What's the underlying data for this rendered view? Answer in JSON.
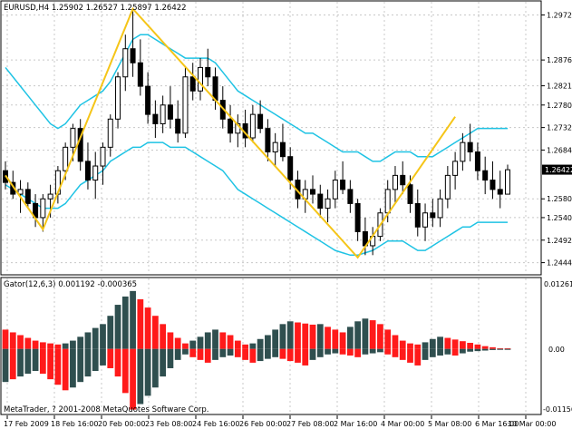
{
  "colors": {
    "background": "#ffffff",
    "grid": "#c8c8c8",
    "bands": "#1fc3e4",
    "zigzag": "#f5c518",
    "candle": "#000000",
    "gator_up": "#2f4f4f",
    "gator_down": "#ff1a1a",
    "price_box": "#000000"
  },
  "main": {
    "header": "EURUSD,H4  1.25902 1.26527 1.25897 1.26422",
    "price_ticks": [
      "1.29720",
      "1.28760",
      "1.28210",
      "1.27800",
      "1.27320",
      "1.26840",
      "1.25800",
      "1.25400",
      "1.24920",
      "1.24440"
    ],
    "current_price_label": "1.26422",
    "current_price": 1.26422
  },
  "indicator": {
    "header": "Gator(12,6,3) 0.001192 -0.000365",
    "top_tick": "0.0126133",
    "zero_tick": "0.00",
    "bottom_tick": "-0.0115613",
    "copyright": "MetaTrader, ? 2001-2008 MetaQuotes Software Corp."
  },
  "time_axis": [
    "17 Feb 2009",
    "18 Feb 16:00",
    "20 Feb 00:00",
    "23 Feb 08:00",
    "24 Feb 16:00",
    "26 Feb 00:00",
    "27 Feb 08:00",
    "2 Mar 16:00",
    "4 Mar 00:00",
    "5 Mar 08:00",
    "6 Mar 16:00",
    "10 Mar 00:00"
  ],
  "chart_data": {
    "type": "candlestick",
    "symbol": "EURUSD",
    "timeframe": "H4",
    "price_range": [
      1.242,
      1.3
    ],
    "candles": [
      [
        1.264,
        1.266,
        1.26,
        1.2615
      ],
      [
        1.2615,
        1.264,
        1.258,
        1.259
      ],
      [
        1.259,
        1.262,
        1.255,
        1.26
      ],
      [
        1.26,
        1.2615,
        1.256,
        1.257
      ],
      [
        1.257,
        1.259,
        1.252,
        1.254
      ],
      [
        1.254,
        1.259,
        1.251,
        1.258
      ],
      [
        1.258,
        1.261,
        1.254,
        1.259
      ],
      [
        1.259,
        1.265,
        1.257,
        1.264
      ],
      [
        1.264,
        1.27,
        1.262,
        1.269
      ],
      [
        1.269,
        1.274,
        1.266,
        1.273
      ],
      [
        1.273,
        1.275,
        1.264,
        1.266
      ],
      [
        1.266,
        1.27,
        1.26,
        1.262
      ],
      [
        1.262,
        1.268,
        1.258,
        1.265
      ],
      [
        1.265,
        1.27,
        1.261,
        1.269
      ],
      [
        1.269,
        1.276,
        1.267,
        1.275
      ],
      [
        1.275,
        1.285,
        1.273,
        1.284
      ],
      [
        1.284,
        1.293,
        1.281,
        1.29
      ],
      [
        1.29,
        1.298,
        1.284,
        1.287
      ],
      [
        1.287,
        1.292,
        1.28,
        1.282
      ],
      [
        1.282,
        1.285,
        1.274,
        1.276
      ],
      [
        1.276,
        1.279,
        1.271,
        1.274
      ],
      [
        1.274,
        1.28,
        1.272,
        1.278
      ],
      [
        1.278,
        1.282,
        1.273,
        1.275
      ],
      [
        1.275,
        1.279,
        1.27,
        1.272
      ],
      [
        1.272,
        1.286,
        1.271,
        1.284
      ],
      [
        1.284,
        1.287,
        1.279,
        1.281
      ],
      [
        1.281,
        1.288,
        1.279,
        1.286
      ],
      [
        1.286,
        1.29,
        1.282,
        1.284
      ],
      [
        1.284,
        1.286,
        1.277,
        1.279
      ],
      [
        1.279,
        1.282,
        1.273,
        1.275
      ],
      [
        1.275,
        1.278,
        1.27,
        1.272
      ],
      [
        1.272,
        1.276,
        1.269,
        1.274
      ],
      [
        1.274,
        1.277,
        1.269,
        1.271
      ],
      [
        1.271,
        1.278,
        1.27,
        1.276
      ],
      [
        1.276,
        1.279,
        1.272,
        1.273
      ],
      [
        1.273,
        1.275,
        1.266,
        1.268
      ],
      [
        1.268,
        1.272,
        1.265,
        1.27
      ],
      [
        1.27,
        1.274,
        1.266,
        1.267
      ],
      [
        1.267,
        1.269,
        1.26,
        1.262
      ],
      [
        1.262,
        1.264,
        1.256,
        1.258
      ],
      [
        1.258,
        1.262,
        1.255,
        1.26
      ],
      [
        1.26,
        1.263,
        1.257,
        1.259
      ],
      [
        1.259,
        1.261,
        1.254,
        1.256
      ],
      [
        1.256,
        1.26,
        1.253,
        1.258
      ],
      [
        1.258,
        1.264,
        1.256,
        1.262
      ],
      [
        1.262,
        1.266,
        1.259,
        1.26
      ],
      [
        1.26,
        1.262,
        1.255,
        1.257
      ],
      [
        1.257,
        1.258,
        1.249,
        1.251
      ],
      [
        1.251,
        1.254,
        1.246,
        1.248
      ],
      [
        1.248,
        1.252,
        1.246,
        1.25
      ],
      [
        1.25,
        1.256,
        1.249,
        1.255
      ],
      [
        1.255,
        1.262,
        1.253,
        1.26
      ],
      [
        1.26,
        1.265,
        1.257,
        1.263
      ],
      [
        1.263,
        1.266,
        1.259,
        1.261
      ],
      [
        1.261,
        1.263,
        1.255,
        1.257
      ],
      [
        1.257,
        1.26,
        1.25,
        1.252
      ],
      [
        1.252,
        1.257,
        1.249,
        1.255
      ],
      [
        1.255,
        1.258,
        1.252,
        1.254
      ],
      [
        1.254,
        1.26,
        1.252,
        1.258
      ],
      [
        1.258,
        1.265,
        1.256,
        1.263
      ],
      [
        1.263,
        1.268,
        1.26,
        1.266
      ],
      [
        1.266,
        1.272,
        1.264,
        1.27
      ],
      [
        1.27,
        1.274,
        1.266,
        1.268
      ],
      [
        1.268,
        1.27,
        1.262,
        1.264
      ],
      [
        1.264,
        1.267,
        1.259,
        1.262
      ],
      [
        1.262,
        1.266,
        1.258,
        1.26
      ],
      [
        1.26,
        1.264,
        1.256,
        1.259
      ],
      [
        1.259,
        1.2653,
        1.259,
        1.2642
      ]
    ],
    "zigzag": [
      [
        0,
        1.263
      ],
      [
        5,
        1.2515
      ],
      [
        17,
        1.2985
      ],
      [
        47,
        1.2455
      ],
      [
        60,
        1.2755
      ]
    ],
    "upper_band": [
      1.286,
      1.284,
      1.282,
      1.28,
      1.278,
      1.276,
      1.274,
      1.273,
      1.274,
      1.276,
      1.278,
      1.279,
      1.28,
      1.281,
      1.283,
      1.286,
      1.289,
      1.292,
      1.293,
      1.293,
      1.292,
      1.291,
      1.29,
      1.289,
      1.288,
      1.288,
      1.288,
      1.288,
      1.287,
      1.285,
      1.283,
      1.281,
      1.28,
      1.279,
      1.278,
      1.277,
      1.276,
      1.275,
      1.274,
      1.273,
      1.272,
      1.272,
      1.271,
      1.27,
      1.269,
      1.268,
      1.268,
      1.268,
      1.267,
      1.266,
      1.266,
      1.267,
      1.268,
      1.268,
      1.268,
      1.267,
      1.267,
      1.267,
      1.268,
      1.269,
      1.27,
      1.271,
      1.272,
      1.273,
      1.273,
      1.273,
      1.273,
      1.273
    ],
    "lower_band": [
      1.261,
      1.26,
      1.259,
      1.258,
      1.257,
      1.256,
      1.256,
      1.256,
      1.257,
      1.259,
      1.261,
      1.262,
      1.263,
      1.264,
      1.266,
      1.267,
      1.268,
      1.269,
      1.269,
      1.27,
      1.27,
      1.27,
      1.269,
      1.269,
      1.269,
      1.268,
      1.267,
      1.266,
      1.265,
      1.264,
      1.262,
      1.26,
      1.259,
      1.258,
      1.257,
      1.256,
      1.255,
      1.254,
      1.253,
      1.252,
      1.251,
      1.25,
      1.249,
      1.248,
      1.247,
      1.2465,
      1.246,
      1.246,
      1.2465,
      1.247,
      1.248,
      1.249,
      1.249,
      1.249,
      1.248,
      1.247,
      1.247,
      1.248,
      1.249,
      1.25,
      1.251,
      1.252,
      1.252,
      1.253,
      1.253,
      1.253,
      1.253,
      1.253
    ],
    "gator_range": [
      -0.0115613,
      0.0126133
    ],
    "gator_upper": [
      [
        0.0035,
        "d"
      ],
      [
        0.003,
        "d"
      ],
      [
        0.0025,
        "d"
      ],
      [
        0.002,
        "d"
      ],
      [
        0.0015,
        "d"
      ],
      [
        0.0012,
        "d"
      ],
      [
        0.001,
        "d"
      ],
      [
        0.0008,
        "d"
      ],
      [
        0.001,
        "u"
      ],
      [
        0.0015,
        "u"
      ],
      [
        0.0022,
        "u"
      ],
      [
        0.003,
        "u"
      ],
      [
        0.0038,
        "u"
      ],
      [
        0.0045,
        "u"
      ],
      [
        0.006,
        "u"
      ],
      [
        0.008,
        "u"
      ],
      [
        0.0095,
        "u"
      ],
      [
        0.0105,
        "u"
      ],
      [
        0.009,
        "d"
      ],
      [
        0.0075,
        "d"
      ],
      [
        0.006,
        "d"
      ],
      [
        0.0045,
        "d"
      ],
      [
        0.003,
        "d"
      ],
      [
        0.002,
        "d"
      ],
      [
        0.001,
        "d"
      ],
      [
        0.0015,
        "u"
      ],
      [
        0.0022,
        "u"
      ],
      [
        0.003,
        "u"
      ],
      [
        0.0035,
        "u"
      ],
      [
        0.003,
        "d"
      ],
      [
        0.0025,
        "d"
      ],
      [
        0.0015,
        "d"
      ],
      [
        0.0008,
        "d"
      ],
      [
        0.001,
        "u"
      ],
      [
        0.0018,
        "u"
      ],
      [
        0.0025,
        "u"
      ],
      [
        0.0035,
        "u"
      ],
      [
        0.0045,
        "u"
      ],
      [
        0.005,
        "u"
      ],
      [
        0.0048,
        "d"
      ],
      [
        0.0046,
        "d"
      ],
      [
        0.0044,
        "d"
      ],
      [
        0.0045,
        "u"
      ],
      [
        0.004,
        "d"
      ],
      [
        0.0035,
        "d"
      ],
      [
        0.003,
        "d"
      ],
      [
        0.004,
        "u"
      ],
      [
        0.005,
        "u"
      ],
      [
        0.0055,
        "u"
      ],
      [
        0.0052,
        "d"
      ],
      [
        0.0045,
        "d"
      ],
      [
        0.0035,
        "d"
      ],
      [
        0.0025,
        "d"
      ],
      [
        0.0015,
        "d"
      ],
      [
        0.001,
        "d"
      ],
      [
        0.0008,
        "d"
      ],
      [
        0.0012,
        "u"
      ],
      [
        0.0018,
        "u"
      ],
      [
        0.0022,
        "u"
      ],
      [
        0.002,
        "d"
      ],
      [
        0.0017,
        "d"
      ],
      [
        0.0014,
        "d"
      ],
      [
        0.0011,
        "d"
      ],
      [
        0.0008,
        "d"
      ],
      [
        0.0005,
        "d"
      ],
      [
        0.0003,
        "d"
      ],
      [
        0.0001,
        "d"
      ],
      [
        0.0001,
        "d"
      ]
    ],
    "gator_lower": [
      [
        -0.006,
        "u"
      ],
      [
        -0.0055,
        "d"
      ],
      [
        -0.005,
        "u"
      ],
      [
        -0.0045,
        "u"
      ],
      [
        -0.004,
        "u"
      ],
      [
        -0.0045,
        "d"
      ],
      [
        -0.0055,
        "d"
      ],
      [
        -0.0065,
        "d"
      ],
      [
        -0.0075,
        "d"
      ],
      [
        -0.007,
        "u"
      ],
      [
        -0.006,
        "u"
      ],
      [
        -0.005,
        "u"
      ],
      [
        -0.004,
        "u"
      ],
      [
        -0.003,
        "u"
      ],
      [
        -0.0035,
        "d"
      ],
      [
        -0.005,
        "d"
      ],
      [
        -0.008,
        "d"
      ],
      [
        -0.011,
        "d"
      ],
      [
        -0.01,
        "u"
      ],
      [
        -0.0085,
        "u"
      ],
      [
        -0.007,
        "u"
      ],
      [
        -0.005,
        "u"
      ],
      [
        -0.0035,
        "u"
      ],
      [
        -0.002,
        "u"
      ],
      [
        -0.001,
        "u"
      ],
      [
        -0.0015,
        "d"
      ],
      [
        -0.002,
        "d"
      ],
      [
        -0.0025,
        "d"
      ],
      [
        -0.002,
        "u"
      ],
      [
        -0.0015,
        "u"
      ],
      [
        -0.0012,
        "u"
      ],
      [
        -0.0015,
        "d"
      ],
      [
        -0.002,
        "d"
      ],
      [
        -0.0025,
        "d"
      ],
      [
        -0.0022,
        "u"
      ],
      [
        -0.0018,
        "u"
      ],
      [
        -0.0015,
        "u"
      ],
      [
        -0.0018,
        "d"
      ],
      [
        -0.0022,
        "d"
      ],
      [
        -0.0025,
        "d"
      ],
      [
        -0.003,
        "d"
      ],
      [
        -0.002,
        "u"
      ],
      [
        -0.0015,
        "u"
      ],
      [
        -0.001,
        "u"
      ],
      [
        -0.0008,
        "u"
      ],
      [
        -0.001,
        "d"
      ],
      [
        -0.0012,
        "d"
      ],
      [
        -0.0015,
        "d"
      ],
      [
        -0.001,
        "u"
      ],
      [
        -0.0008,
        "u"
      ],
      [
        -0.0006,
        "u"
      ],
      [
        -0.001,
        "d"
      ],
      [
        -0.0015,
        "d"
      ],
      [
        -0.002,
        "d"
      ],
      [
        -0.0025,
        "d"
      ],
      [
        -0.003,
        "d"
      ],
      [
        -0.002,
        "u"
      ],
      [
        -0.0015,
        "u"
      ],
      [
        -0.0012,
        "u"
      ],
      [
        -0.001,
        "u"
      ],
      [
        -0.0012,
        "d"
      ],
      [
        -0.0008,
        "u"
      ],
      [
        -0.0005,
        "u"
      ],
      [
        -0.0004,
        "u"
      ],
      [
        -0.0003,
        "u"
      ],
      [
        -0.0002,
        "u"
      ],
      [
        -0.0001,
        "u"
      ],
      [
        -0.0001,
        "u"
      ]
    ]
  }
}
